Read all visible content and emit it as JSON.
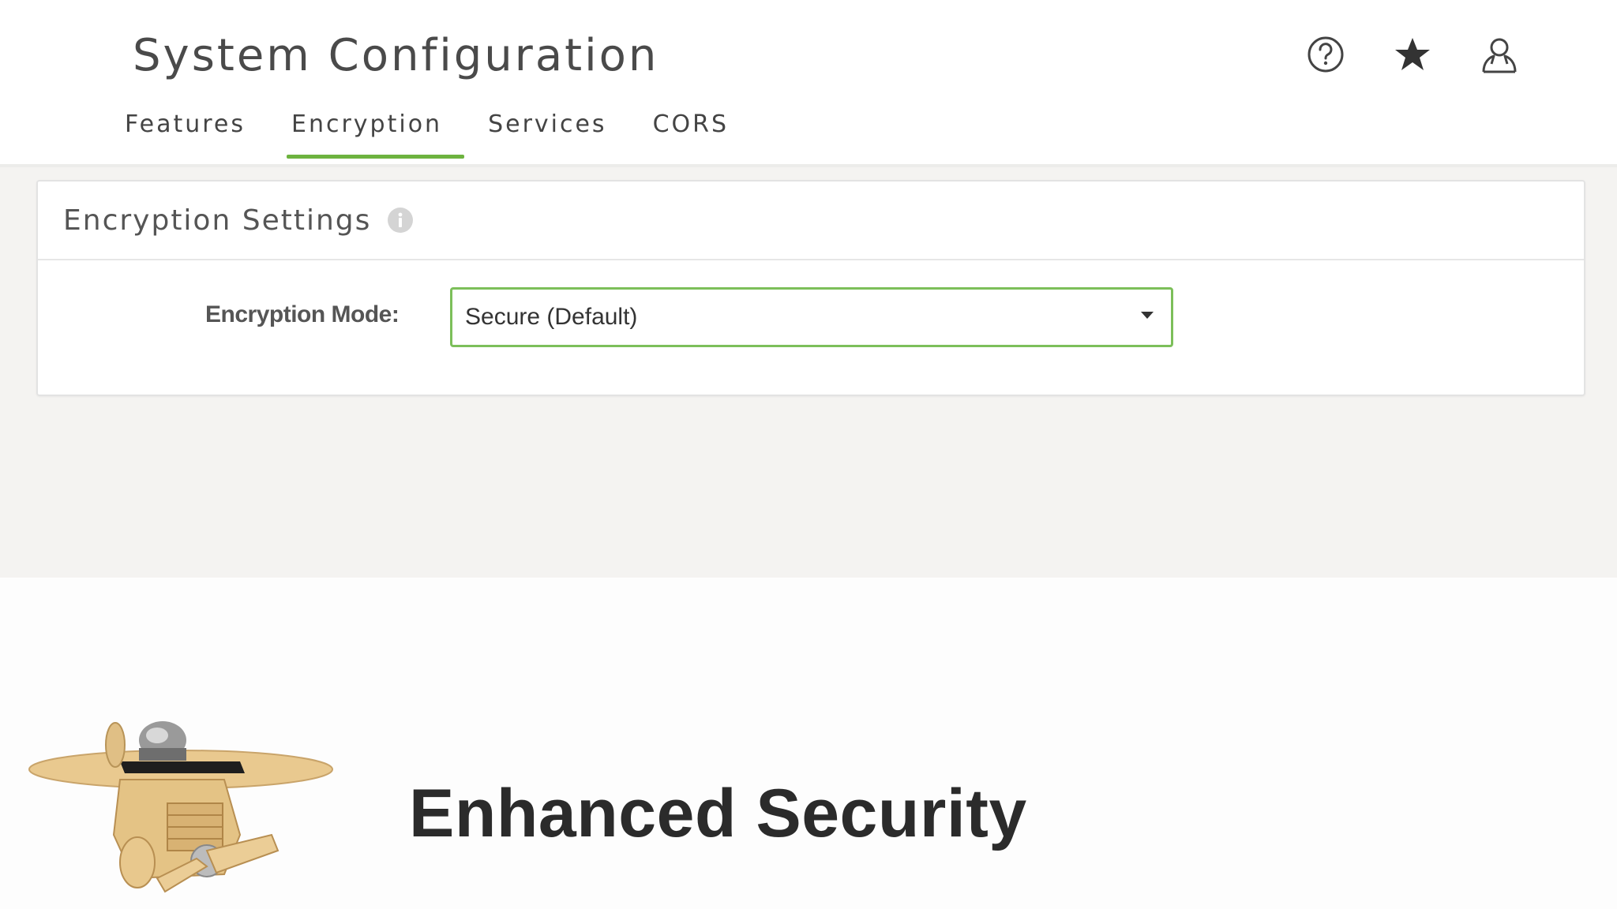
{
  "header": {
    "title": "System Configuration",
    "icons": [
      "help-icon",
      "star-icon",
      "user-icon"
    ]
  },
  "tabs": [
    {
      "label": "Features",
      "active": false
    },
    {
      "label": "Encryption",
      "active": true
    },
    {
      "label": "Services",
      "active": false
    },
    {
      "label": "CORS",
      "active": false
    }
  ],
  "settings_card": {
    "title": "Encryption Settings",
    "info_icon": "info-icon",
    "field_label": "Encryption Mode:",
    "field_value": "Secure (Default)"
  },
  "overlay": {
    "caption": "Enhanced Security",
    "mascot": "airplane-robot-illustration"
  },
  "colors": {
    "accent": "#6db33f",
    "select_border": "#7cbf5a",
    "page_bg": "#f4f3f1"
  }
}
